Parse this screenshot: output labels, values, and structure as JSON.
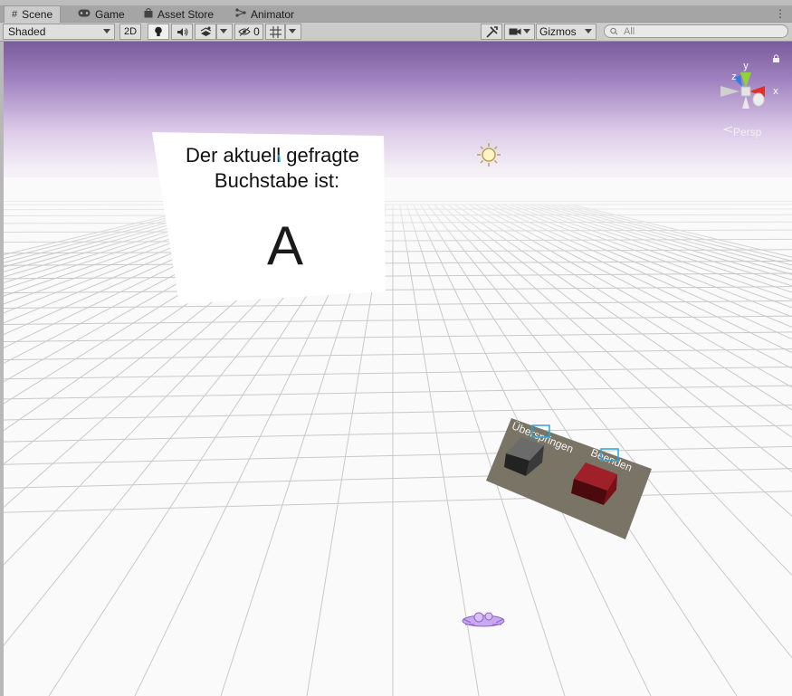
{
  "tabs": [
    {
      "label": "Scene",
      "icon": "grid-icon"
    },
    {
      "label": "Game",
      "icon": "gamepad-icon"
    },
    {
      "label": "Asset Store",
      "icon": "store-bag-icon"
    },
    {
      "label": "Animator",
      "icon": "animator-icon"
    }
  ],
  "toolbar": {
    "shading_mode": "Shaded",
    "mode_2d": "2D",
    "hidden_count": "0",
    "gizmos": "Gizmos",
    "search_placeholder": "All"
  },
  "scene": {
    "sign_line1": "Der aktuell gefragte",
    "sign_line2": "Buchstabe ist:",
    "sign_letter": "A",
    "skip_label": "Überspringen",
    "quit_label": "Beenden",
    "skip_button_color": "#3a3a3a",
    "quit_button_color": "#7a0f14",
    "panel_color": "#7a7466"
  },
  "gizmo": {
    "axis_y": "y",
    "axis_x": "x",
    "axis_z": "z",
    "projection": "Persp",
    "colors": {
      "x": "#e0302a",
      "y": "#8fd23a",
      "z": "#3a7ae0"
    }
  },
  "sky": {
    "top": "#7a5c9c",
    "horizon": "#e6dcef",
    "ground": "#fafafa"
  }
}
